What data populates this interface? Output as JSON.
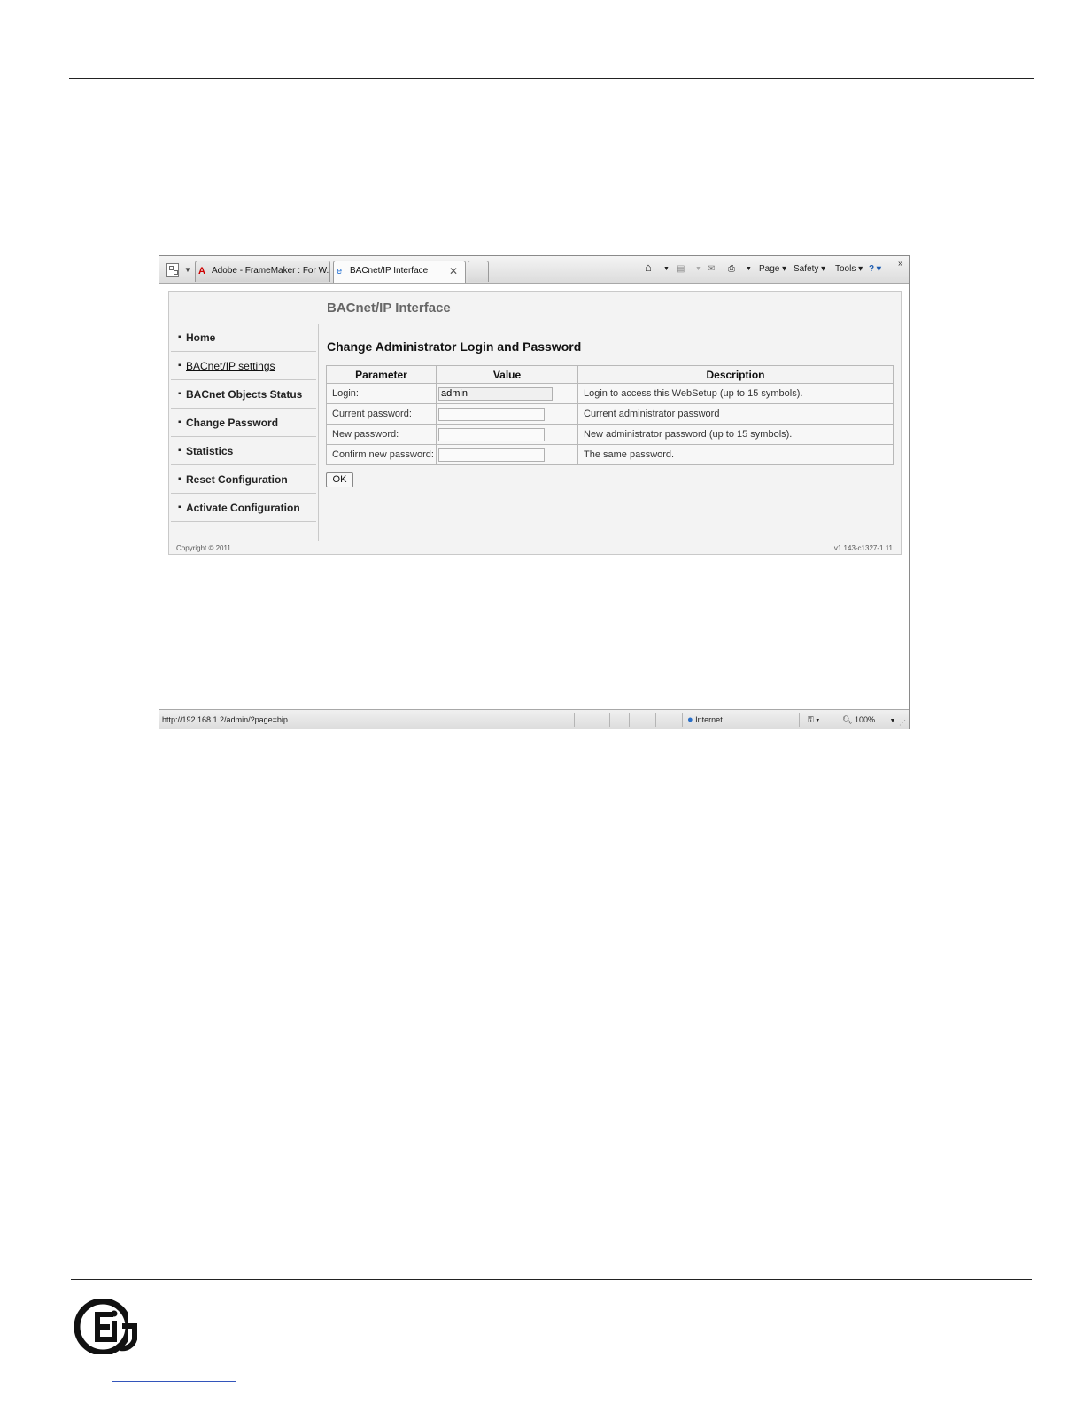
{
  "browser": {
    "tabs": [
      {
        "label": "Adobe - FrameMaker : For W...",
        "icon": "adobe-icon"
      },
      {
        "label": "BACnet/IP Interface",
        "icon": "ie-icon",
        "active": true
      }
    ],
    "commands": {
      "page": "Page",
      "safety": "Safety",
      "tools": "Tools",
      "chevron": "»"
    },
    "status": {
      "url": "http://192.168.1.2/admin/?page=bip",
      "zone": "Internet",
      "zoom": "100%"
    }
  },
  "webpage": {
    "title": "BACnet/IP Interface",
    "nav": [
      {
        "label": "Home",
        "active": false
      },
      {
        "label": "BACnet/IP settings",
        "active": true
      },
      {
        "label": "BACnet Objects Status",
        "active": false
      },
      {
        "label": "Change Password",
        "active": false
      },
      {
        "label": "Statistics",
        "active": false
      },
      {
        "label": "Reset Configuration",
        "active": false
      },
      {
        "label": "Activate Configuration",
        "active": false
      }
    ],
    "section_title": "Change Administrator Login and Password",
    "table": {
      "headers": [
        "Parameter",
        "Value",
        "Description"
      ],
      "rows": [
        {
          "parameter": "Login:",
          "value": "admin",
          "description": "Login to access this WebSetup (up to 15 symbols)."
        },
        {
          "parameter": "Current password:",
          "value": "",
          "description": "Current administrator password"
        },
        {
          "parameter": "New password:",
          "value": "",
          "description": "New administrator password (up to 15 symbols)."
        },
        {
          "parameter": "Confirm new password:",
          "value": "",
          "description": "The same password."
        }
      ]
    },
    "ok_label": "OK",
    "copyright": "Copyright © 2011",
    "version": "v1.143-c1327-1.11"
  }
}
